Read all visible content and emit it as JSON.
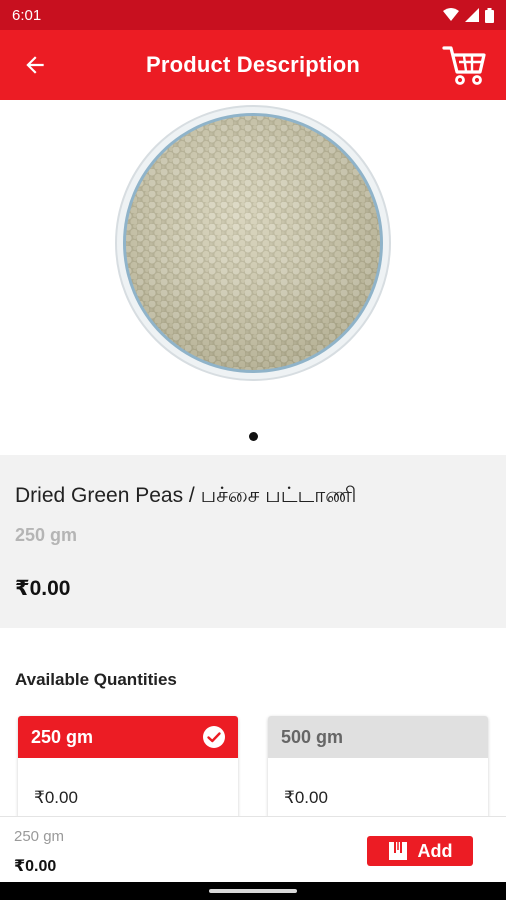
{
  "status_bar": {
    "time": "6:01"
  },
  "app_bar": {
    "title": "Product Description"
  },
  "product": {
    "name": "Dried Green Peas / பச்சை பட்டாணி",
    "weight": "250 gm",
    "price": "₹0.00",
    "carousel": {
      "total": 1,
      "active": 1
    }
  },
  "quantities": {
    "heading": "Available Quantities",
    "options": [
      {
        "label": "250 gm",
        "price": "₹0.00",
        "selected": true
      },
      {
        "label": "500 gm",
        "price": "₹0.00",
        "selected": false
      }
    ]
  },
  "bottom_bar": {
    "weight": "250 gm",
    "price": "₹0.00",
    "add_label": "Add"
  },
  "colors": {
    "brand_red": "#ec1c24",
    "status_red": "#c8101f"
  }
}
